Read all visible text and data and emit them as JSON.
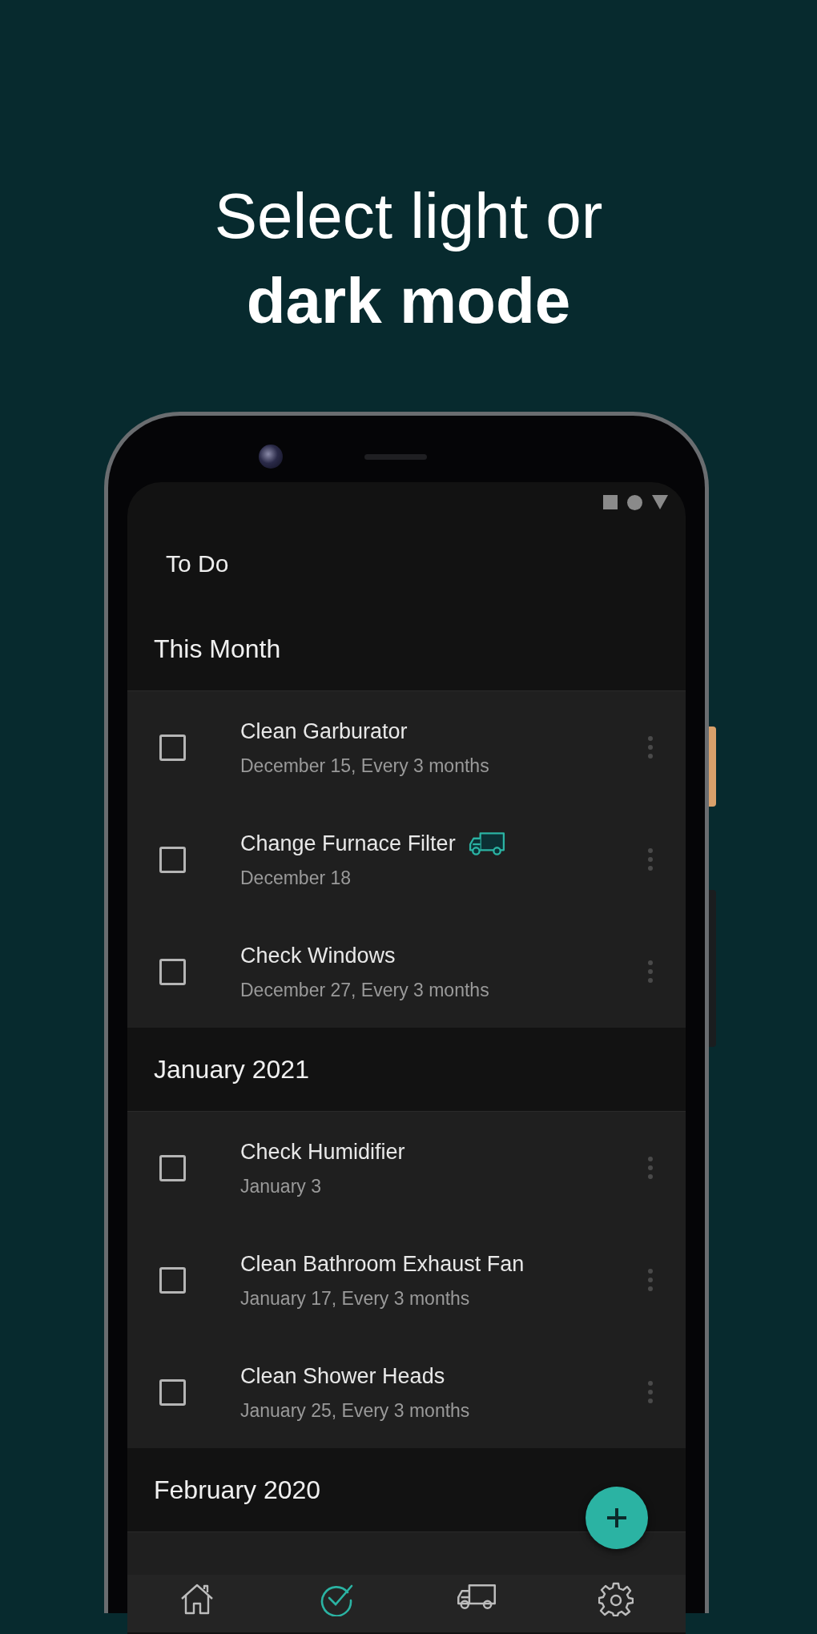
{
  "headline": {
    "line_1": "Select light or",
    "line_2": "dark mode"
  },
  "app_title": "To Do",
  "sections": [
    {
      "title": "This Month",
      "items": [
        {
          "title": "Clean Garburator",
          "subtitle": "December 15, Every 3 months",
          "checked": false,
          "truck_icon": false
        },
        {
          "title": "Change Furnace Filter",
          "subtitle": "December 18",
          "checked": false,
          "truck_icon": true
        },
        {
          "title": "Check Windows",
          "subtitle": "December 27, Every 3 months",
          "checked": false,
          "truck_icon": false
        }
      ]
    },
    {
      "title": "January 2021",
      "items": [
        {
          "title": "Check Humidifier",
          "subtitle": "January 3",
          "checked": false,
          "truck_icon": false
        },
        {
          "title": "Clean Bathroom Exhaust Fan",
          "subtitle": "January 17, Every 3 months",
          "checked": false,
          "truck_icon": false
        },
        {
          "title": "Clean Shower Heads",
          "subtitle": "January 25, Every 3 months",
          "checked": false,
          "truck_icon": false
        }
      ]
    },
    {
      "title": "February 2020"
    }
  ],
  "nav": [
    {
      "selected": false
    },
    {
      "selected": true
    },
    {
      "selected": false
    },
    {
      "selected": false
    }
  ]
}
